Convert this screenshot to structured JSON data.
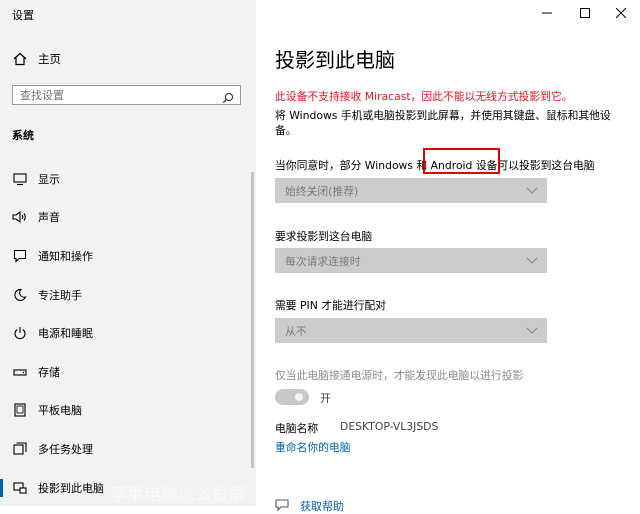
{
  "window": {
    "title": "设置"
  },
  "sidebar": {
    "home_label": "主页",
    "search_placeholder": "查找设置",
    "section_label": "系统",
    "items": [
      {
        "label": "显示",
        "icon": "monitor-icon"
      },
      {
        "label": "声音",
        "icon": "speaker-icon"
      },
      {
        "label": "通知和操作",
        "icon": "notification-icon"
      },
      {
        "label": "专注助手",
        "icon": "moon-icon"
      },
      {
        "label": "电源和睡眠",
        "icon": "power-icon"
      },
      {
        "label": "存储",
        "icon": "storage-icon"
      },
      {
        "label": "平板电脑",
        "icon": "tablet-icon"
      },
      {
        "label": "多任务处理",
        "icon": "multitask-icon"
      },
      {
        "label": "投影到此电脑",
        "icon": "project-icon",
        "active": true
      }
    ]
  },
  "main": {
    "title": "投影到此电脑",
    "warning": "此设备不支持接收 Miracast，因此不能以无线方式投影到它。",
    "description": "将 Windows 手机或电脑投影到此屏幕，并使用其键盘、鼠标和其他设备。",
    "setting1_label": "当你同意时，部分 Windows 和 Android 设备可以投影到这台电脑",
    "setting1_value": "始终关闭(推荐)",
    "setting2_label": "要求投影到这台电脑",
    "setting2_value": "每次请求连接时",
    "setting3_label": "需要 PIN 才能进行配对",
    "setting3_value": "从不",
    "power_hint": "仅当此电脑接通电源时，才能发现此电脑以进行投影",
    "toggle_label": "开",
    "toggle_on": true,
    "pc_name_label": "电脑名称",
    "pc_name_value": "DESKTOP-VL3JSDS",
    "rename_link": "重命名你的电脑",
    "get_help": "获取帮助"
  },
  "overlay": {
    "watermark": "苹果电脑怎么投屏"
  },
  "colors": {
    "accent": "#0063b1",
    "warning": "#e81123",
    "highlight_box": "#dd0000"
  }
}
